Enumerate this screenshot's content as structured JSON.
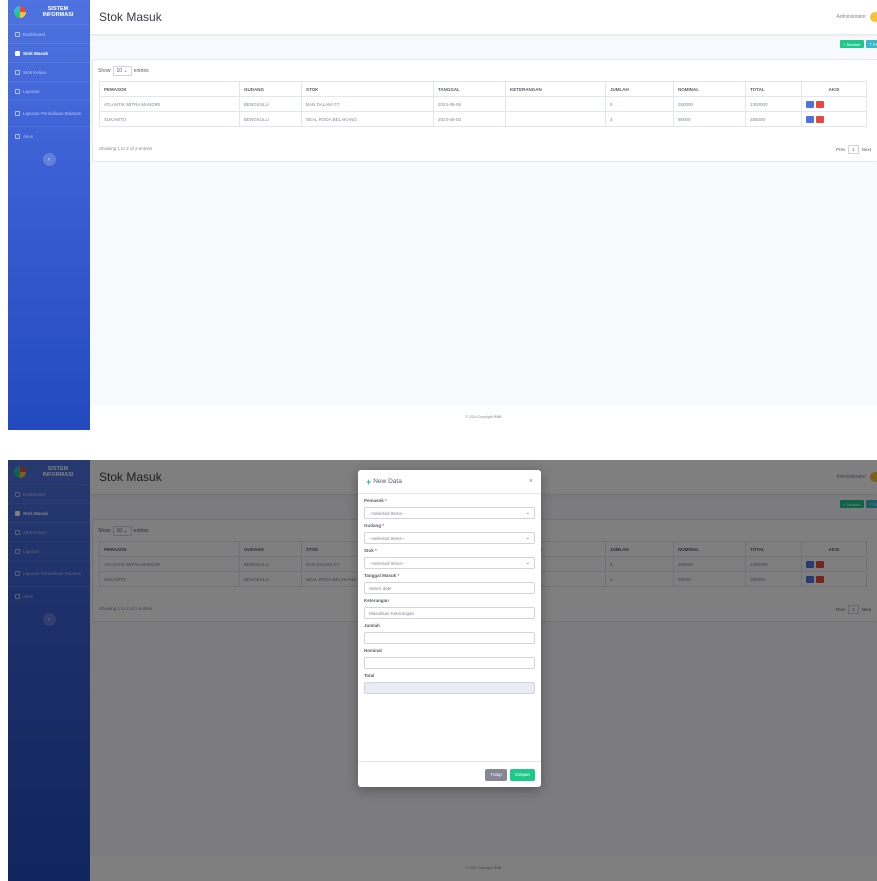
{
  "app": {
    "brand_line1": "SISTEM",
    "brand_line2": "INFORMASI"
  },
  "sidebar": {
    "items": [
      {
        "label": "Dashboard",
        "active": false
      },
      {
        "label": "Stok Masuk",
        "active": true
      },
      {
        "label": "Stok Keluar",
        "active": false
      },
      {
        "label": "Laporan",
        "active": false
      },
      {
        "label": "Laporan Persediaan Bulanan",
        "active": false
      },
      {
        "label": "Akun",
        "active": false
      }
    ],
    "toggle_icon": "chevron-left-icon"
  },
  "header": {
    "page_title": "Stok Masuk",
    "user_name": "Administrator"
  },
  "toolbar": {
    "add_label": "+ Tambah",
    "filter_label": "⊤ Filter"
  },
  "table": {
    "show_label": "Show",
    "length_value": "10",
    "entries_label": "entries",
    "columns": [
      "PEMASOK",
      "GUDANG",
      "STOK",
      "TANGGAL",
      "KETERANGAN",
      "JUMLAH",
      "NOMINAL",
      "TOTAL",
      "AKSI"
    ],
    "rows": [
      [
        "ATLANTIK MITRA MANDIRI",
        "BENGKULU",
        "BAN DALAM GT",
        "2024-06-06",
        "",
        "5",
        "260000",
        "1300000"
      ],
      [
        "SUKAMTO",
        "BENGKULU",
        "SEAL RODA BELAKANG",
        "2024-06-03",
        "",
        "3",
        "95000",
        "285000"
      ]
    ],
    "info": "Showing 1 to 2 of 2 entries",
    "prev_label": "Prev",
    "page": "1",
    "next_label": "Next"
  },
  "footer": {
    "copyright": "© 2024 Copyright RMB"
  },
  "modal": {
    "title": "New Data",
    "close": "×",
    "fields": [
      {
        "label": "Pemasok",
        "required": "*",
        "value": "--Selected Items--"
      },
      {
        "label": "Gudang",
        "required": "*",
        "value": "--Selected Items--"
      },
      {
        "label": "Stok",
        "required": "*",
        "value": "--Selected Items--"
      },
      {
        "label": "Tanggal Masuk",
        "required": "*",
        "placeholder": "Select date"
      },
      {
        "label": "Keterangan",
        "placeholder": "Masukkan Keterangan"
      },
      {
        "label": "Jumlah",
        "value": ""
      },
      {
        "label": "Nominal",
        "value": ""
      },
      {
        "label": "Total",
        "value": ""
      }
    ],
    "close_button": "Tutup",
    "save_button": "Simpan"
  },
  "colors": {
    "primary": "#4e73df",
    "success": "#1cc88a",
    "info": "#36b9cc",
    "danger": "#e74a3b"
  }
}
